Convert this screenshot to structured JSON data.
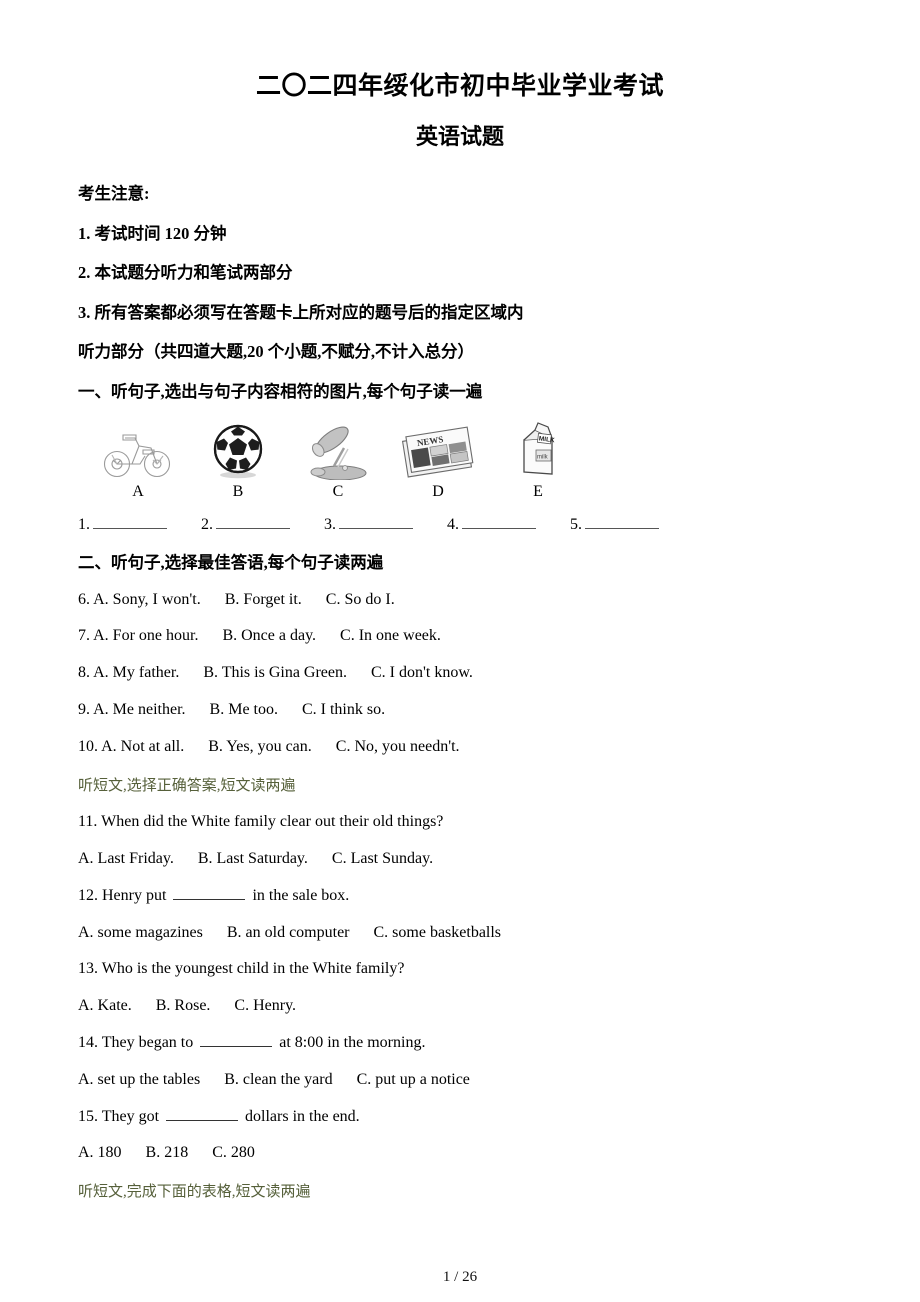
{
  "document": {
    "title": "二〇二四年绥化市初中毕业学业考试",
    "subtitle": "英语试题",
    "footer_page": "1 / 26"
  },
  "notice": {
    "label": "考生注意:",
    "items": [
      "1. 考试时间 120 分钟",
      "2. 本试题分听力和笔试两部分",
      "3. 所有答案都必须写在答题卡上所对应的题号后的指定区域内"
    ]
  },
  "listening": {
    "part_line": "听力部分（共四道大题,20 个小题,不赋分,不计入总分）",
    "section_one_head": "一、听句子,选出与句子内容相符的图片,每个句子读一遍",
    "pictures": [
      {
        "label": "A",
        "icon": "bicycle-icon"
      },
      {
        "label": "B",
        "icon": "soccer-ball-icon"
      },
      {
        "label": "C",
        "icon": "desk-lamp-icon"
      },
      {
        "label": "D",
        "icon": "newspaper-icon"
      },
      {
        "label": "E",
        "icon": "milk-carton-icon"
      }
    ],
    "blanks": [
      "1.",
      "2.",
      "3.",
      "4.",
      "5."
    ],
    "section_two_head": "二、听句子,选择最佳答语,每个句子读两遍",
    "section_two_questions": [
      "6. A. Sony, I won't.      B. Forget it.      C. So do I.",
      "7. A. For one hour.      B. Once a day.      C. In one week.",
      "8. A. My father.      B. This is Gina Green.      C. I don't know.",
      "9. A. Me neither.      B. Me too.      C. I think so.",
      "10. A. Not at all.      B. Yes, you can.      C. No, you needn't."
    ],
    "section_three_head": "听短文,选择正确答案,短文读两遍",
    "q11_stem": "11. When did the White family clear out their old things?",
    "q11_options": "A. Last Friday.      B. Last Saturday.      C. Last Sunday.",
    "q12_stem_before": "12. Henry put ",
    "q12_stem_after": " in the sale box.",
    "q12_options": "A. some magazines      B. an old computer      C. some basketballs",
    "q13_stem": "13. Who is the youngest child in the White family?",
    "q13_options": "A. Kate.      B. Rose.      C. Henry.",
    "q14_stem_before": "14. They began to ",
    "q14_stem_after": " at 8:00 in the morning.",
    "q14_options": "A. set up the tables      B. clean the yard      C. put up a notice",
    "q15_stem_before": "15. They got ",
    "q15_stem_after": " dollars in the end.",
    "q15_options": "A. 180      B. 218      C. 280",
    "section_four_head": "听短文,完成下面的表格,短文读两遍"
  },
  "colors": {
    "text": "#000000",
    "green_heading": "#56603a",
    "rule": "#555555"
  }
}
